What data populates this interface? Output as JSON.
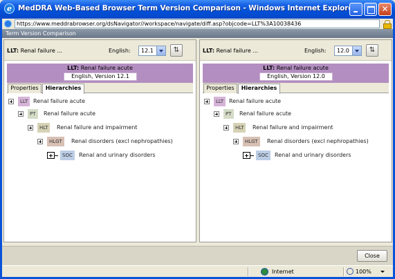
{
  "window": {
    "title": "MedDRA Web-Based Browser Term Version Comparison - Windows Internet Explorer provided by North...",
    "url": "https://www.meddrabrowser.org/dsNavigator//workspace/navigate/diff.asp?objcode=LLT%3A10038436"
  },
  "dialog": {
    "title": "Term Version Comparison",
    "close_label": "Close"
  },
  "panes": [
    {
      "llt_prefix": "LLT:",
      "llt_short": "Renal failure ...",
      "language_label": "English:",
      "version_value": "12.1",
      "banner_prefix": "LLT:",
      "banner_term": "Renal failure acute",
      "banner_version": "English, Version 12.1",
      "tabs": [
        "Properties",
        "Hierarchies"
      ],
      "tree": [
        {
          "level": "LLT",
          "name": "Renal failure acute"
        },
        {
          "level": "PT",
          "name": "Renal failure acute"
        },
        {
          "level": "HLT",
          "name": "Renal failure and impairment"
        },
        {
          "level": "HLGT",
          "name": "Renal disorders (excl nephropathies)"
        },
        {
          "level": "SOC",
          "name": "Renal and urinary disorders"
        }
      ]
    },
    {
      "llt_prefix": "LLT:",
      "llt_short": "Renal failure ...",
      "language_label": "English:",
      "version_value": "12.0",
      "banner_prefix": "LLT:",
      "banner_term": "Renal failure acute",
      "banner_version": "English, Version 12.0",
      "tabs": [
        "Properties",
        "Hierarchies"
      ],
      "tree": [
        {
          "level": "LLT",
          "name": "Renal failure acute"
        },
        {
          "level": "PT",
          "name": "Renal failure acute"
        },
        {
          "level": "HLT",
          "name": "Renal failure and impairment"
        },
        {
          "level": "HLGT",
          "name": "Renal disorders (excl nephropathies)"
        },
        {
          "level": "SOC",
          "name": "Renal and urinary disorders"
        }
      ]
    }
  ],
  "status": {
    "zone": "Internet",
    "zoom": "100%"
  },
  "colors": {
    "banner": "#b38ec0",
    "llt": "#d6b4d8",
    "pt": "#d4dcc8",
    "hlt": "#d6d2b6",
    "hlgt": "#d8c0b4",
    "soc": "#bccde6"
  }
}
